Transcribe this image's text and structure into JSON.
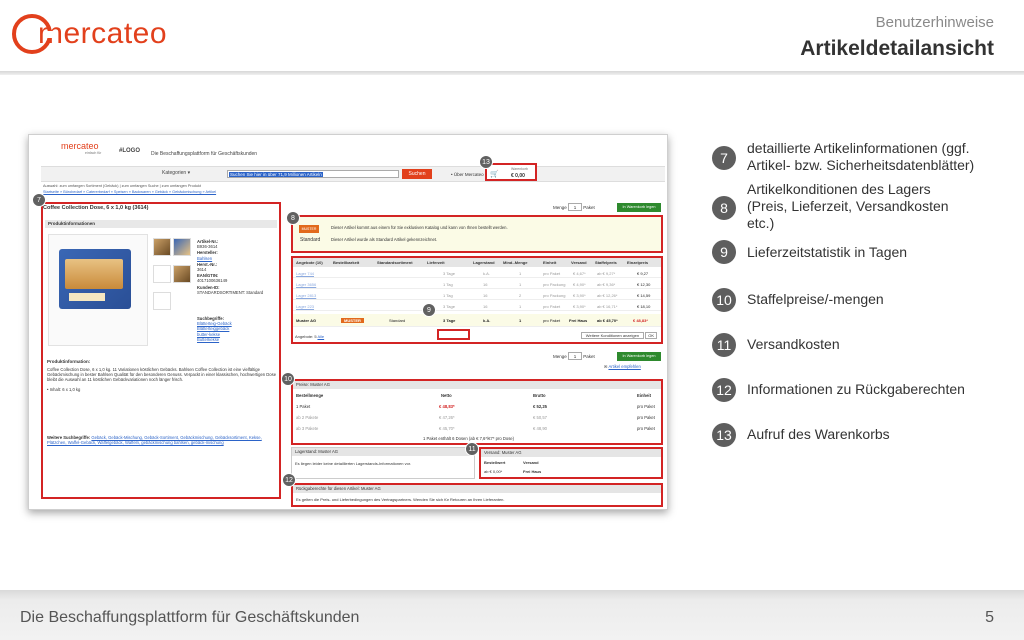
{
  "header": {
    "logo_text": "mercateo",
    "subtitle": "Benutzerhinweise",
    "title": "Artikeldetailansicht"
  },
  "footer": {
    "text": "Die Beschaffungsplattform für Geschäftskunden",
    "page_number": "5"
  },
  "screenshot": {
    "logo": "mercateo",
    "logo_sub": "einfach für",
    "my_logo": "#LOGO",
    "tagline": "Die Beschaffungsplattform für Geschäftskunden",
    "category_label": "Kategorien",
    "search_value": "Suchen Sie hier in über 71,9 Millionen Artikeln",
    "search_button": "Suchen",
    "ueber": "• Über Mercateo",
    "cart_label": "Warenkorb",
    "cart_value": "€ 0,00",
    "breadcrumb_line1": "Auswahl: zum umfangen Sortiment (Gebäck) | zum umfangen Suche | zum umfangen Produkt",
    "breadcrumb_line2": "Startseite » Bürobedarf » Catererbedarf » Speisen » Backwaren » Gebäck » Gebäckmischung » Artikel",
    "product_title": "Coffee Collection Dose, 6 x 1,0 kg (3614)",
    "product_info_head": "Produktinformationen",
    "attr_artnr_label": "Artikel-Nr.:",
    "attr_artnr": "B936-3614",
    "attr_hersteller_label": "Hersteller:",
    "attr_hersteller": "Bahlsen",
    "attr_herstnr_label": "Herst.-Nr.:",
    "attr_herstnr": "3614",
    "attr_ean_label": "EAN/GTIN:",
    "attr_ean": "4017100636149",
    "attr_kunden_label": "Kunden-ID:",
    "attr_kunden": "STANDARDSORTIMENT: Standard",
    "tags_label": "Suchbegriffe:",
    "tags": [
      "Blätterteig-Gebäck",
      "Blätterteiggebäck",
      "butter-kekse",
      "Butterkekse"
    ],
    "prodinfo_head": "Produktinformation:",
    "prodinfo_text": "Coffee Collection Dose, 6 x 1,0 kg. 11 Variationen köstlichen Gebäcks. Bahlsen Coffee Collection ist eine vielfältige Gebäckmischung in bester Bahlsen Qualität für den besonderen Genuss. Verpackt in einer klassischen, hochwertigen Dose bleibt die Auswahl an 11 köstlichen Gebäckvariationen noch länger frisch.",
    "prodinfo_bullet": "• Inhalt: 6 x 1,0 kg",
    "more_terms_label": "Weitere Suchbegriffe:",
    "more_terms": "Gebäck, Gebäck-Mischung, Gebäck-Sortiment, Gebäckmischung, Gebäcksortiment, Kekse, Plätzchen, Waffel-Gebäck, Waffelgebäck, Waffeln, gebäckmischung bahlsen, gebäck-mischung",
    "qty_label": "Menge",
    "qty_value": "1",
    "qty_unit": "Paket",
    "cart_btn": "In Warenkorb legen",
    "muster_tag": "MUSTER",
    "standard": "Standard",
    "offer_line1": "Dieser Artikel kommt aus einem für Sie exklusiven Katalog und kann von Ihnen bestellt werden.",
    "offer_line2": "Dieser Artikel wurde als Standard Artikel gekennzeichnet.",
    "table_headers": [
      "Angebote (10)",
      "Bestellbarkeit",
      "Standardsortiment",
      "Lieferzeit",
      "Lagerstand",
      "Mind.-Menge",
      "Einheit",
      "Versand",
      "Staffelpreis",
      "Einzelpreis"
    ],
    "table_rows": [
      {
        "lager": "Lager 744",
        "lieferzeit": "3 Tage",
        "stand": "k.A.",
        "mind": "1",
        "einheit": "pro Paket",
        "versand": "€ 4,67*",
        "staffel": "ab € 9,27*",
        "einzel": "€ 9,27"
      },
      {
        "lager": "Lager 3656",
        "lieferzeit": "1 Tag",
        "stand": "16",
        "mind": "1",
        "einheit": "pro Packung",
        "versand": "€ 4,90*",
        "staffel": "ab € 9,36*",
        "einzel": "€ 12,30"
      },
      {
        "lager": "Lager 2813",
        "lieferzeit": "1 Tag",
        "stand": "16",
        "mind": "2",
        "einheit": "pro Packung",
        "versand": "€ 3,90*",
        "staffel": "ab € 12,26*",
        "einzel": "€ 14,59"
      },
      {
        "lager": "Lager 223",
        "lieferzeit": "3 Tage",
        "stand": "16",
        "mind": "1",
        "einheit": "pro Paket",
        "versand": "€ 3,90*",
        "staffel": "ab € 16,71*",
        "einzel": "€ 18,10"
      }
    ],
    "main_row": {
      "anbieter": "Muster AG",
      "tag": "MUSTER",
      "standard": "Standard",
      "lieferzeit": "3 Tage",
      "stand": "k.A.",
      "mind": "1",
      "einheit": "pro Paket",
      "versand": "Frei Haus",
      "staffel": "ab € 45,70*",
      "einzel": "€ 48,83*"
    },
    "table_foot_left": "Angebote: 5",
    "table_foot_link": "Alle",
    "table_foot_right": "Weitere Konditionen anzeigen",
    "table_foot_ok": "OK",
    "empf": "Artikel empfehlen",
    "preise_head": "Preise: Muster AG",
    "preise_cols": [
      "Bestellmenge",
      "Netto",
      "Brutto",
      "Einheit"
    ],
    "preise_rows": [
      {
        "menge": "1 Paket",
        "netto": "€ 48,83*",
        "brutto": "€ 52,25",
        "einheit": "pro Paket"
      },
      {
        "menge": "ab 2 Pakete",
        "netto": "€ 47,26*",
        "brutto": "€ 50,57",
        "einheit": "pro Paket"
      },
      {
        "menge": "ab 3 Pakete",
        "netto": "€ 45,70*",
        "brutto": "€ 48,90",
        "einheit": "pro Paket"
      }
    ],
    "preise_foot": "1 Paket enthält 6 Dosen (ab € 7,6*/€7* pro Dose)",
    "lager_head": "Lagerstand: Muster AG",
    "lager_text": "Es liegen leider keine detaillierten Lagerstands-Informationen vor.",
    "versand_head": "Versand: Muster AG",
    "versand_col1": "Bestellwert",
    "versand_col2": "Versand",
    "versand_val1": "ab € 0,00*",
    "versand_val2": "Frei Haus",
    "rueck_head": "Rückgaberechte für diesen Artikel: Muster AG",
    "rueck_text": "Es gelten die Preis- und Lieferbedingungen des Vertragspartners. Wenden Sie sich für Retouren an Ihren Lieferanten."
  },
  "badges": {
    "b7": "7",
    "b8": "8",
    "b9": "9",
    "b10": "10",
    "b11": "11",
    "b12": "12",
    "b13": "13"
  },
  "legend": [
    {
      "num": "7",
      "text": "detaillierte Artikelinformationen (ggf. Artikel- bzw. Sicherheitsdatenblätter)"
    },
    {
      "num": "8",
      "text": "Artikelkonditionen des Lagers (Preis, Lieferzeit, Versandkosten etc.)"
    },
    {
      "num": "9",
      "text": "Lieferzeitstatistik in Tagen"
    },
    {
      "num": "10",
      "text": "Staffelpreise/-mengen"
    },
    {
      "num": "11",
      "text": "Versandkosten"
    },
    {
      "num": "12",
      "text": "Informationen zu Rückgaberechten"
    },
    {
      "num": "13",
      "text": "Aufruf des Warenkorbs"
    }
  ],
  "colors": {
    "brand": "#e2401c",
    "highlight": "#d32424",
    "badge": "#5e5e5e"
  }
}
